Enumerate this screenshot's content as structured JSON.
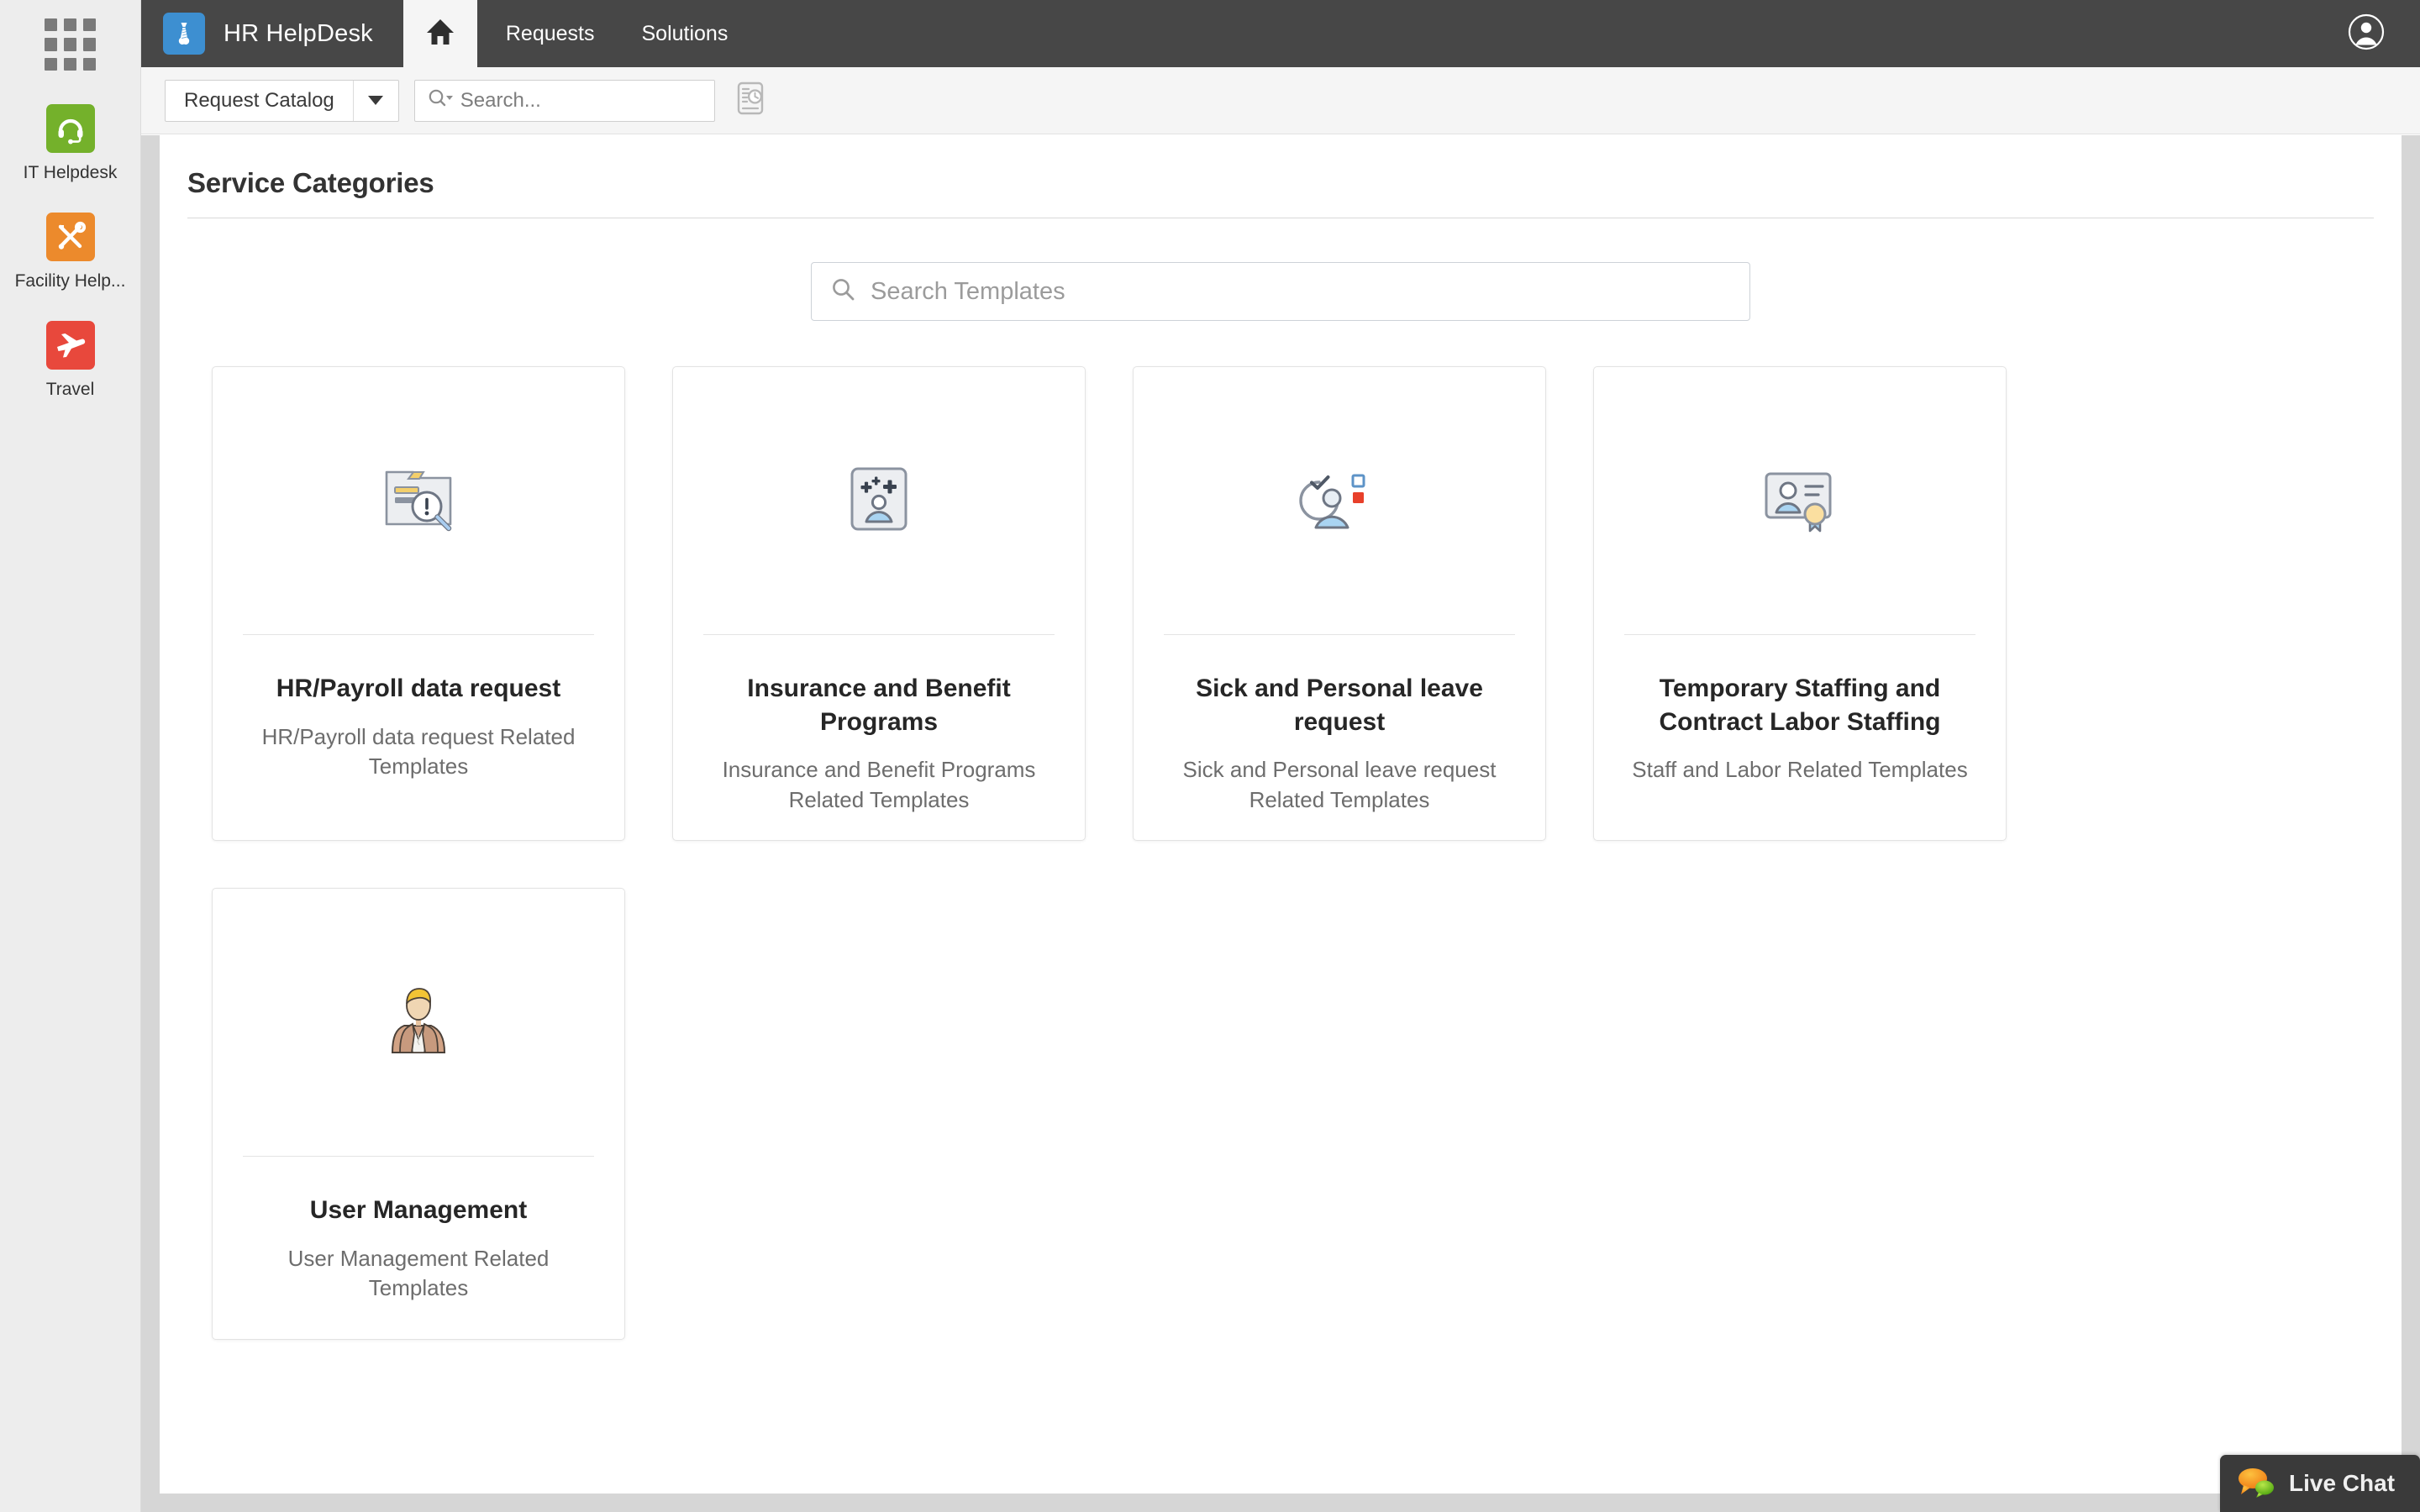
{
  "app_rail": {
    "launcher": {
      "name": "app-launcher",
      "label": "Apps"
    },
    "items": [
      {
        "label": "IT Helpdesk",
        "icon": "headset-icon",
        "color": "#74b12b"
      },
      {
        "label": "Facility Help...",
        "icon": "tools-icon",
        "color": "#ec8a2c"
      },
      {
        "label": "Travel",
        "icon": "airplane-icon",
        "color": "#e8483c"
      }
    ]
  },
  "topbar": {
    "brand_title": "HR HelpDesk",
    "brand_icon": "necktie-icon",
    "brand_color": "#3d8fd1",
    "background": "#474747",
    "home_icon": "home-icon",
    "nav": [
      {
        "label": "Requests"
      },
      {
        "label": "Solutions"
      }
    ],
    "profile_icon": "user-circle-icon"
  },
  "toolbar": {
    "catalog_label": "Request Catalog",
    "catalog_caret_icon": "chevron-down-icon",
    "search_placeholder": "Search...",
    "search_value": "",
    "search_icon": "search-dropdown-icon",
    "history_icon": "recent-history-icon"
  },
  "main": {
    "page_title": "Service Categories",
    "template_search": {
      "placeholder": "Search Templates",
      "value": "",
      "icon": "search-icon"
    },
    "cards": [
      {
        "title": "HR/Payroll data request",
        "description": "HR/Payroll data request Related Templates",
        "icon": "folder-magnifier-alert-icon"
      },
      {
        "title": "Insurance and Benefit Programs",
        "description": "Insurance and Benefit Programs Related Templates",
        "icon": "person-plus-card-icon"
      },
      {
        "title": "Sick and Personal leave request",
        "description": "Sick and Personal leave request Related Templates",
        "icon": "person-clock-check-icon"
      },
      {
        "title": "Temporary Staffing and Contract Labor Staffing",
        "description": "Staff and Labor Related Templates",
        "icon": "id-badge-award-icon"
      },
      {
        "title": "User Management",
        "description": "User Management Related Templates",
        "icon": "businessman-avatar-icon"
      }
    ]
  },
  "live_chat": {
    "label": "Live Chat",
    "icon": "chat-bubbles-icon",
    "background": "#3a3a3a"
  }
}
